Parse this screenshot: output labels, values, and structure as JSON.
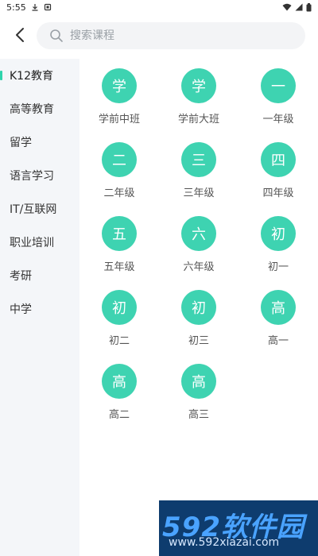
{
  "status_bar": {
    "time": "5:55",
    "icons": [
      "download-icon",
      "notification-icon",
      "wifi-icon",
      "signal-icon",
      "battery-icon"
    ]
  },
  "header": {
    "back_icon": "back-arrow-icon",
    "search": {
      "icon": "search-icon",
      "placeholder": "搜索课程",
      "value": ""
    }
  },
  "sidebar": {
    "items": [
      {
        "label": "K12教育",
        "active": true
      },
      {
        "label": "高等教育",
        "active": false
      },
      {
        "label": "留学",
        "active": false
      },
      {
        "label": "语言学习",
        "active": false
      },
      {
        "label": "IT/互联网",
        "active": false
      },
      {
        "label": "职业培训",
        "active": false
      },
      {
        "label": "考研",
        "active": false
      },
      {
        "label": "中学",
        "active": false
      }
    ]
  },
  "grades": [
    {
      "icon_char": "学",
      "label": "学前中班"
    },
    {
      "icon_char": "学",
      "label": "学前大班"
    },
    {
      "icon_char": "一",
      "label": "一年级"
    },
    {
      "icon_char": "二",
      "label": "二年级"
    },
    {
      "icon_char": "三",
      "label": "三年级"
    },
    {
      "icon_char": "四",
      "label": "四年级"
    },
    {
      "icon_char": "五",
      "label": "五年级"
    },
    {
      "icon_char": "六",
      "label": "六年级"
    },
    {
      "icon_char": "初",
      "label": "初一"
    },
    {
      "icon_char": "初",
      "label": "初二"
    },
    {
      "icon_char": "初",
      "label": "初三"
    },
    {
      "icon_char": "高",
      "label": "高一"
    },
    {
      "icon_char": "高",
      "label": "高二"
    },
    {
      "icon_char": "高",
      "label": "高三"
    }
  ],
  "colors": {
    "accent": "#3ed3b1",
    "indicator": "#2fd4ac",
    "sidebar_bg": "#f4f6f9",
    "search_bg": "#f3f4f6"
  },
  "watermark": {
    "top": "592软件园",
    "bottom": "www.592xiazai.com"
  }
}
